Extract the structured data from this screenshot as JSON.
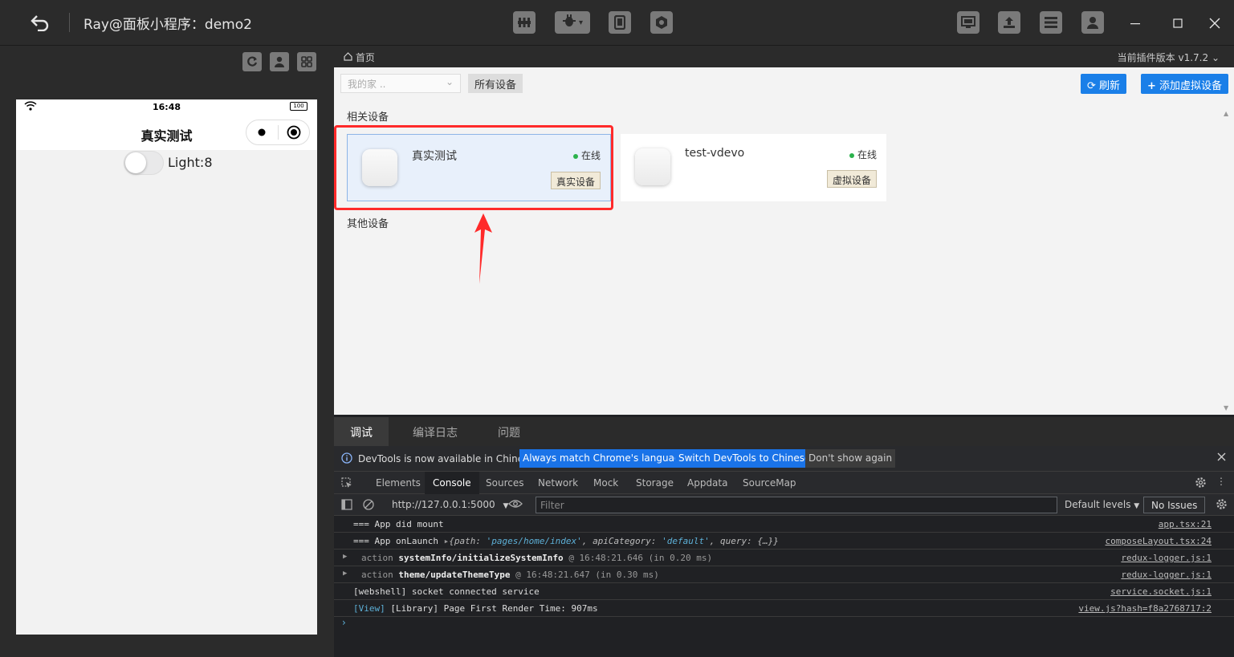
{
  "titlebar": {
    "title": "Ray@面板小程序：demo2",
    "buttons": [
      "chip-icon",
      "bug-icon",
      "phone-icon",
      "plugin-icon",
      "preview-icon",
      "upload-icon",
      "menu-icon",
      "user-icon"
    ]
  },
  "simulator": {
    "status_time": "16:48",
    "battery": "100",
    "page_title": "真实测试",
    "light_label": "Light:8"
  },
  "main": {
    "breadcrumb": "首页",
    "plugin_version": "当前插件版本 v1.7.2",
    "home_select_placeholder": "我的家 ..",
    "all_devices": "所有设备",
    "refresh": "刷新",
    "add_virtual": "添加虚拟设备",
    "related_label": "相关设备",
    "other_label": "其他设备",
    "devices": [
      {
        "name": "真实测试",
        "status": "在线",
        "tag": "真实设备"
      },
      {
        "name": "test-vdevo",
        "status": "在线",
        "tag": "虚拟设备"
      }
    ]
  },
  "devtools": {
    "tabs": [
      "调试",
      "编译日志",
      "问题"
    ],
    "info_text": "DevTools is now available in Chinese!",
    "info_btn_match": "Always match Chrome's language",
    "info_btn_switch": "Switch DevTools to Chinese",
    "info_btn_dismiss": "Don't show again",
    "panel_tabs": [
      "Elements",
      "Console",
      "Sources",
      "Network",
      "Mock",
      "Storage",
      "Appdata",
      "SourceMap"
    ],
    "url": "http://127.0.0.1:5000",
    "filter_placeholder": "Filter",
    "levels": "Default levels",
    "issues": "No Issues",
    "logs": [
      {
        "text": "=== App did mount",
        "src": "app.tsx:21"
      },
      {
        "text": "=== App onLaunch",
        "obj_path_key": "path",
        "obj_path_val": "'pages/home/index'",
        "obj_api_key": "apiCategory",
        "obj_api_val": "'default'",
        "obj_query": "query: {…}}",
        "src": "composeLayout.tsx:24"
      },
      {
        "prefix": "action",
        "action": "systemInfo/initializeSystemInfo",
        "time": "@ 16:48:21.646 (in 0.20 ms)",
        "src": "redux-logger.js:1"
      },
      {
        "prefix": "action",
        "action": "theme/updateThemeType",
        "time": "@ 16:48:21.647 (in 0.30 ms)",
        "src": "redux-logger.js:1"
      },
      {
        "text": "[webshell] socket connected service",
        "src": "service.socket.js:1"
      },
      {
        "view": "[View]",
        "text": "[Library] Page First Render Time: 907ms",
        "src": "view.js?hash=f8a2768717:2"
      }
    ]
  },
  "colors": {
    "accent": "#1a7fe8",
    "highlight": "#ff2a2a",
    "online": "#2bb24c"
  }
}
